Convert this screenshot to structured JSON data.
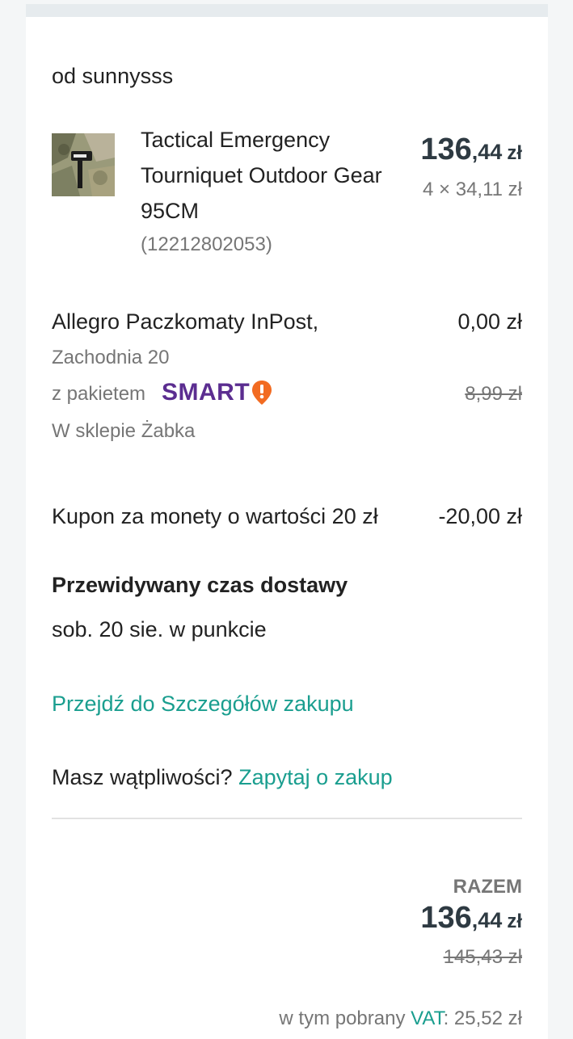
{
  "seller": "od sunnysss",
  "product": {
    "title": "Tactical Emergency Tourniquet Outdoor Gear 95CM",
    "id": "(12212802053)",
    "price_int": "136",
    "price_dec": ",44",
    "price_unit": "zł",
    "quantity_price": "4 × 34,11 zł"
  },
  "shipping": {
    "name": "Allegro Paczkomaty InPost,",
    "price": "0,00 zł",
    "address": "Zachodnia 20",
    "package_label": "z pakietem",
    "smart_label": "SMART",
    "old_price": "8,99 zł",
    "pickup": "W sklepie Żabka"
  },
  "coupon": {
    "label": "Kupon za monety o wartości 20 zł",
    "value": "-20,00 zł"
  },
  "delivery": {
    "heading": "Przewidywany czas dostawy",
    "value": "sob. 20 sie. w punkcie"
  },
  "details_link": "Przejdź do Szczegółów zakupu",
  "doubt": {
    "text": "Masz wątpliwości?",
    "link": "Zapytaj o zakup"
  },
  "total": {
    "label": "RAZEM",
    "price_int": "136",
    "price_dec": ",44",
    "price_unit": "zł",
    "old_price": "145,43 zł",
    "vat_prefix": "w tym pobrany",
    "vat_link": "VAT",
    "vat_value": ": 25,52 zł"
  },
  "colors": {
    "accent": "#1a9e8f",
    "price": "#2e3a42",
    "smart": "#5b2d90",
    "smart_badge": "#f26b21"
  }
}
